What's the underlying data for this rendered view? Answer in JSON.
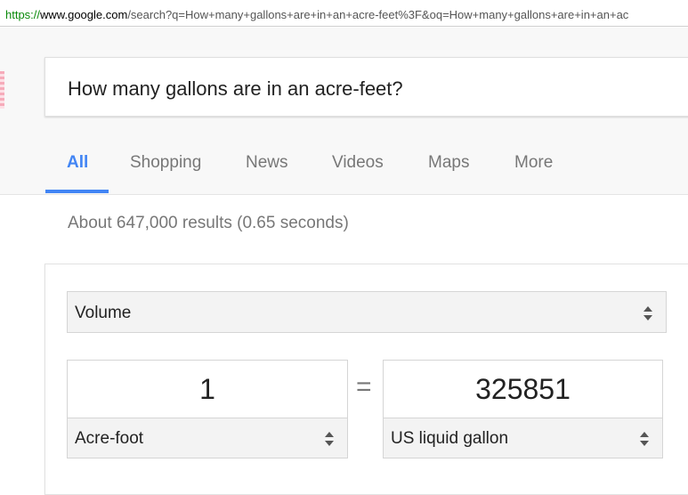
{
  "browser": {
    "url_scheme": "https://",
    "url_host": "www.google.com",
    "url_rest": "/search?q=How+many+gallons+are+in+an+acre-feet%3F&oq=How+many+gallons+are+in+an+ac"
  },
  "search": {
    "query": "How many gallons are in an acre-feet?"
  },
  "tabs": [
    {
      "label": "All",
      "active": true
    },
    {
      "label": "Shopping",
      "active": false
    },
    {
      "label": "News",
      "active": false
    },
    {
      "label": "Videos",
      "active": false
    },
    {
      "label": "Maps",
      "active": false
    },
    {
      "label": "More",
      "active": false
    }
  ],
  "results_stats": "About 647,000 results (0.65 seconds)",
  "converter": {
    "category": "Volume",
    "left_value": "1",
    "equals": "=",
    "right_value": "325851",
    "left_unit": "Acre-foot",
    "right_unit": "US liquid gallon"
  },
  "colors": {
    "accent": "#4285f4",
    "muted_text": "#777777",
    "select_bg": "#f3f3f3"
  }
}
